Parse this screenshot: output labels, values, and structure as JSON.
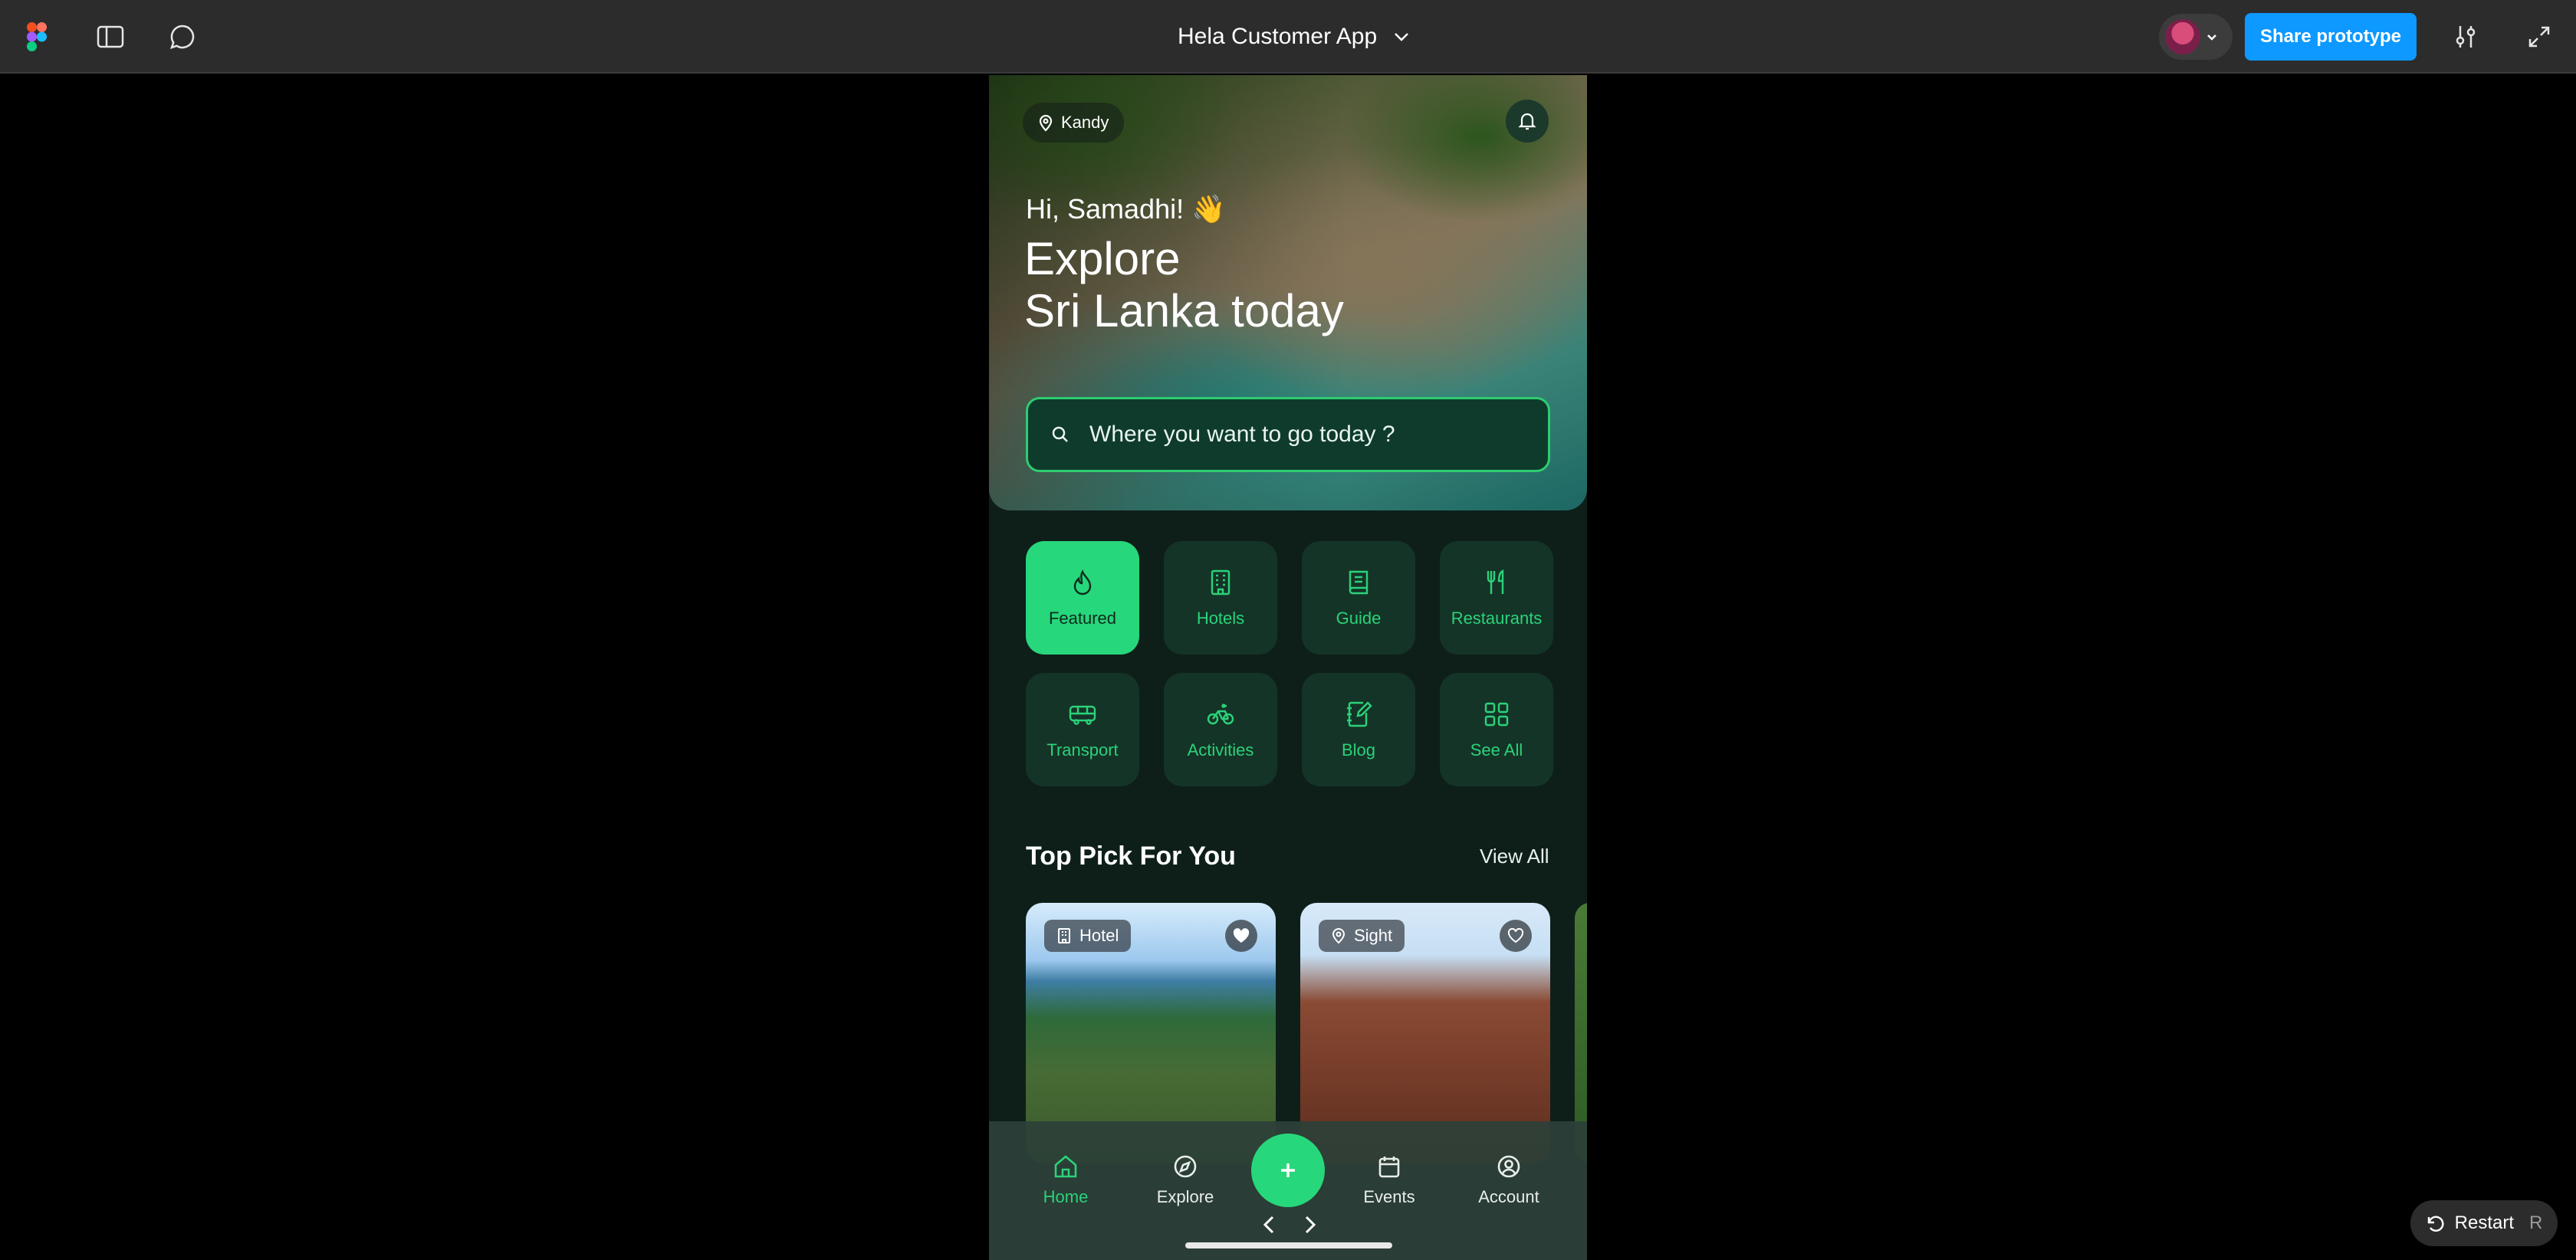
{
  "toolbar": {
    "file_title": "Hela Customer App",
    "share_label": "Share prototype"
  },
  "app": {
    "location": "Kandy",
    "greeting": "Hi, Samadhi! 👋",
    "headline_line1": "Explore",
    "headline_line2": "Sri Lanka today",
    "search_placeholder": "Where you want to go today ?",
    "categories": [
      {
        "label": "Featured",
        "icon": "flame-icon",
        "active": true
      },
      {
        "label": "Hotels",
        "icon": "building-icon",
        "active": false
      },
      {
        "label": "Guide",
        "icon": "book-icon",
        "active": false
      },
      {
        "label": "Restaurants",
        "icon": "utensils-icon",
        "active": false
      },
      {
        "label": "Transport",
        "icon": "bus-icon",
        "active": false
      },
      {
        "label": "Activities",
        "icon": "bicycle-icon",
        "active": false
      },
      {
        "label": "Blog",
        "icon": "notebook-pen-icon",
        "active": false
      },
      {
        "label": "See All",
        "icon": "grid-icon",
        "active": false
      }
    ],
    "top_pick": {
      "title": "Top Pick For You",
      "view_all": "View All",
      "cards": [
        {
          "tag": "Hotel",
          "tag_icon": "building-icon",
          "favorited": true
        },
        {
          "tag": "Sight",
          "tag_icon": "map-pin-icon",
          "favorited": false
        }
      ]
    },
    "nav": {
      "home": "Home",
      "explore": "Explore",
      "events": "Events",
      "account": "Account"
    }
  },
  "restart": {
    "label": "Restart",
    "shortcut": "R"
  },
  "colors": {
    "accent": "#27d77b",
    "figma_blue": "#0d99ff"
  }
}
